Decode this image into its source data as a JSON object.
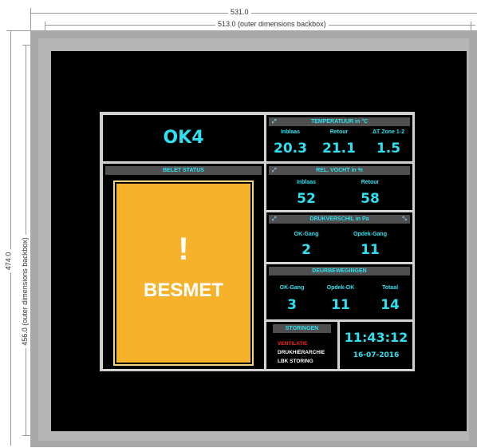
{
  "dimensions": {
    "width_outer": "531.0",
    "width_backbox": "513.0  (outer dimensions backbox)",
    "height_outer": "474.0",
    "height_backbox": "456.0  (outer dimensions backbox)"
  },
  "room": {
    "name": "OK4"
  },
  "status": {
    "header": "BELET STATUS",
    "icon": "!",
    "text": "BESMET",
    "color": "#f5b22a"
  },
  "temperature": {
    "header": "TEMPERATUUR in °C",
    "labels": [
      "Inblaas",
      "Retour",
      "ΔT Zone 1-2"
    ],
    "values": [
      "20.3",
      "21.1",
      "1.5"
    ]
  },
  "humidity": {
    "header": "REL. VOCHT  in %",
    "labels": [
      "Inblaas",
      "Retour"
    ],
    "values": [
      "52",
      "58"
    ]
  },
  "pressure": {
    "header": "DRUKVERSCHIL in Pa",
    "labels": [
      "OK-Gang",
      "Opdek-Gang"
    ],
    "values": [
      "2",
      "11"
    ]
  },
  "doors": {
    "header": "DEURBEWEGINGEN",
    "labels": [
      "OK-Gang",
      "Opdek-OK",
      "Totaal"
    ],
    "values": [
      "3",
      "11",
      "14"
    ]
  },
  "faults": {
    "header": "STORINGEN",
    "items": [
      "VENTILATIE",
      "DRUKHIËRARCHIE",
      "LBK STORING"
    ],
    "alert_color": "#ff2a2a"
  },
  "clock": {
    "time": "11:43:12",
    "date": "16-07-2016"
  },
  "accent_color": "#2fe0f0"
}
